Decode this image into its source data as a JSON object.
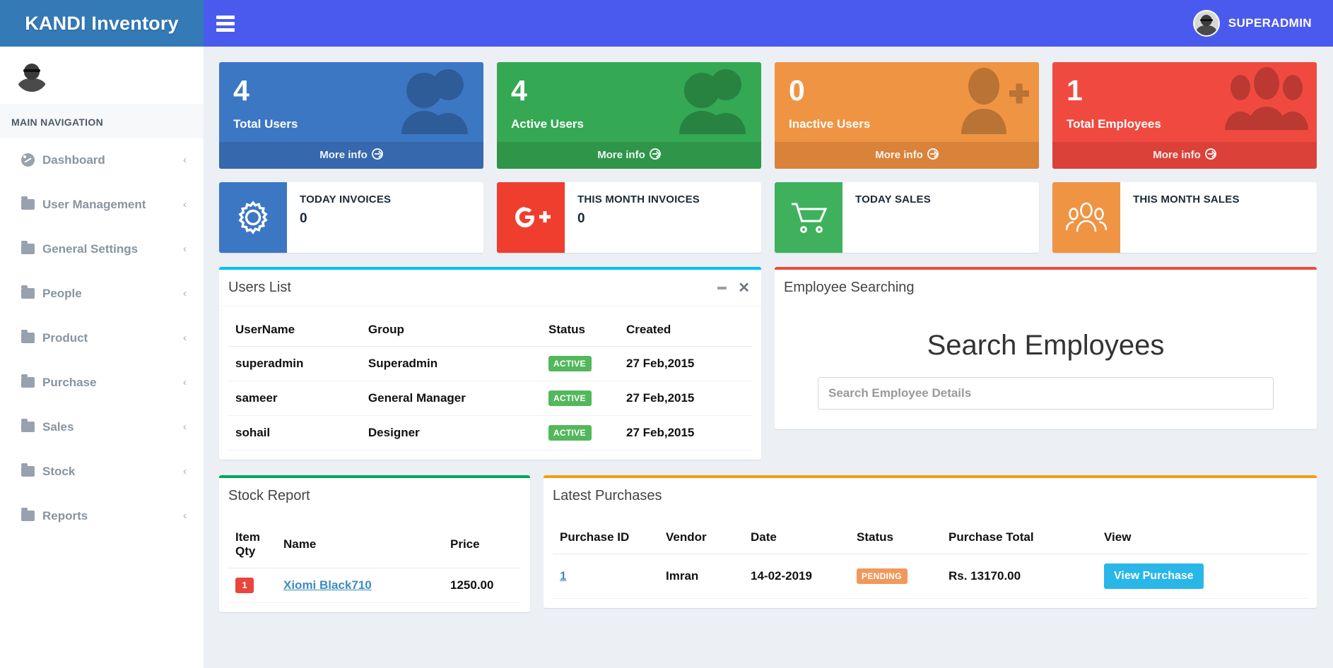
{
  "header": {
    "logo": "KANDI Inventory",
    "menu_toggle_icon": "hamburger-icon",
    "user_name": "SUPERADMIN"
  },
  "sidebar": {
    "nav_header": "MAIN NAVIGATION",
    "items": [
      {
        "label": "Dashboard",
        "icon": "gauge-icon",
        "arrow": "‹"
      },
      {
        "label": "User Management",
        "icon": "folder-icon",
        "arrow": "‹"
      },
      {
        "label": "General Settings",
        "icon": "folder-icon",
        "arrow": "‹"
      },
      {
        "label": "People",
        "icon": "folder-icon",
        "arrow": "‹"
      },
      {
        "label": "Product",
        "icon": "folder-icon",
        "arrow": "‹"
      },
      {
        "label": "Purchase",
        "icon": "folder-icon",
        "arrow": "‹"
      },
      {
        "label": "Sales",
        "icon": "folder-icon",
        "arrow": "‹"
      },
      {
        "label": "Stock",
        "icon": "folder-icon",
        "arrow": "‹"
      },
      {
        "label": "Reports",
        "icon": "folder-icon",
        "arrow": "‹"
      }
    ]
  },
  "stat_cards": [
    {
      "value": "4",
      "label": "Total Users",
      "more": "More info",
      "color": "#3c77c4",
      "footer_color": "#3568ad",
      "icon": "two-users-icon"
    },
    {
      "value": "4",
      "label": "Active Users",
      "more": "More info",
      "color": "#34a853",
      "footer_color": "#2e9549",
      "icon": "two-users-icon"
    },
    {
      "value": "0",
      "label": "Inactive Users",
      "more": "More info",
      "color": "#ef9443",
      "footer_color": "#d9823a",
      "icon": "user-plus-icon"
    },
    {
      "value": "1",
      "label": "Total Employees",
      "more": "More info",
      "color": "#f04a40",
      "footer_color": "#db4139",
      "icon": "three-users-icon"
    }
  ],
  "small_boxes": [
    {
      "title": "TODAY INVOICES",
      "value": "0",
      "color": "#3c77c4",
      "icon": "gear-icon"
    },
    {
      "title": "THIS MONTH INVOICES",
      "value": "0",
      "color": "#ef3e2e",
      "icon": "google-plus-icon"
    },
    {
      "title": "TODAY SALES",
      "value": "",
      "color": "#3fb15d",
      "icon": "shopping-cart-icon"
    },
    {
      "title": "THIS MONTH SALES",
      "value": "",
      "color": "#ef9443",
      "icon": "group-icon"
    }
  ],
  "users_panel": {
    "title": "Users List",
    "accent": "#00c0ef",
    "minimize_icon": "minimize-icon",
    "close_icon": "close-icon",
    "columns": [
      "UserName",
      "Group",
      "Status",
      "Created"
    ],
    "rows": [
      {
        "username": "superadmin",
        "group": "Superadmin",
        "status": "ACTIVE",
        "created": "27 Feb,2015"
      },
      {
        "username": "sameer",
        "group": "General Manager",
        "status": "ACTIVE",
        "created": "27 Feb,2015"
      },
      {
        "username": "sohail",
        "group": "Designer",
        "status": "ACTIVE",
        "created": "27 Feb,2015"
      }
    ]
  },
  "employee_panel": {
    "title": "Employee Searching",
    "accent": "#e84c3d",
    "heading": "Search Employees",
    "search_placeholder": "Search Employee Details",
    "search_value": ""
  },
  "stock_panel": {
    "title": "Stock Report",
    "accent": "#00a65a",
    "columns": [
      "Item Qty",
      "Name",
      "Price"
    ],
    "rows": [
      {
        "qty": "1",
        "name": "Xiomi Black710",
        "price": "1250.00"
      }
    ]
  },
  "purchases_panel": {
    "title": "Latest Purchases",
    "accent": "#f39c12",
    "columns": [
      "Purchase ID",
      "Vendor",
      "Date",
      "Status",
      "Purchase Total",
      "View"
    ],
    "rows": [
      {
        "id": "1",
        "vendor": "Imran",
        "date": "14-02-2019",
        "status": "PENDING",
        "total": "Rs. 13170.00",
        "view_label": "View Purchase"
      }
    ]
  }
}
